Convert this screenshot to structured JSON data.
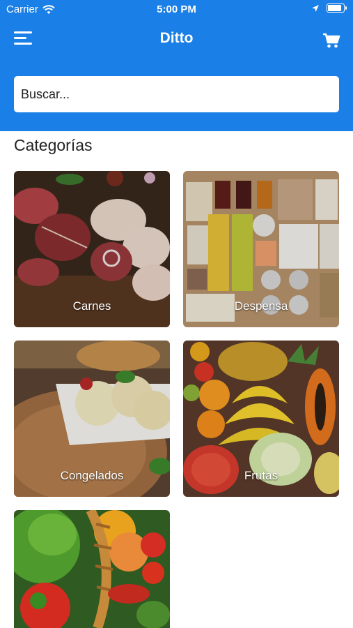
{
  "status_bar": {
    "carrier": "Carrier",
    "time": "5:00 PM",
    "battery_level": 0.95
  },
  "navbar": {
    "title": "Ditto",
    "menu_icon": "hamburger-menu-icon",
    "cart_icon": "shopping-cart-icon"
  },
  "search": {
    "placeholder": "Buscar..."
  },
  "categories_title": "Categorías",
  "categories": [
    {
      "label": "Carnes"
    },
    {
      "label": "Despensa"
    },
    {
      "label": "Congelados"
    },
    {
      "label": "Frutas"
    },
    {
      "label": ""
    }
  ],
  "colors": {
    "header": "#1a7fe6",
    "background": "#ffffff"
  }
}
